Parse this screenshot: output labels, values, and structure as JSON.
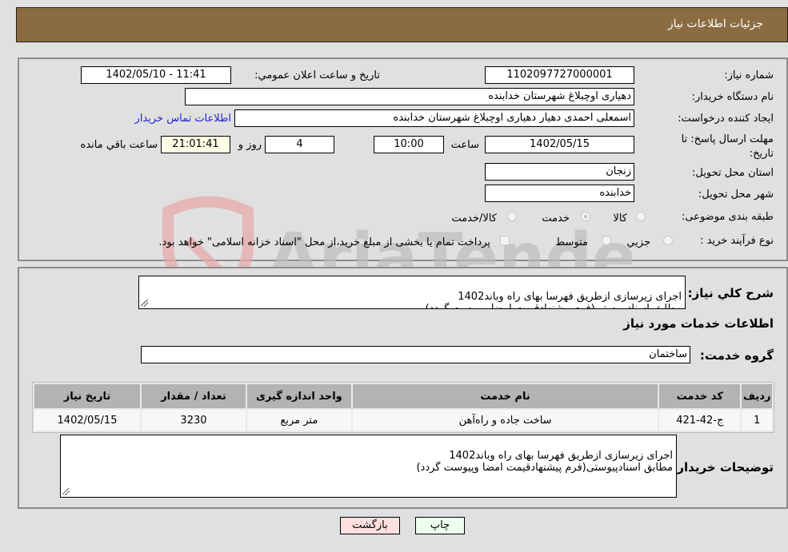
{
  "header": {
    "title": "جزئیات اطلاعات نیاز"
  },
  "fields": {
    "need_number": {
      "label": "شماره نیاز:",
      "value": "1102097727000001"
    },
    "announce_datetime": {
      "label": "تاریخ و ساعت اعلان عمومي:",
      "value": "1402/05/10 - 11:41"
    },
    "buyer_org": {
      "label": "نام دستگاه خریدار:",
      "value": "دهیاری اوچبلاغ شهرستان خدابنده"
    },
    "requester": {
      "label": "ایجاد کننده درخواست:",
      "value": "اسمعلی احمدی دهیار دهیاری اوچبلاغ شهرستان خدابنده"
    },
    "contact_link": "اطلاعات تماس خریدار",
    "deadline": {
      "label": "مهلت ارسال پاسخ: تا تاریخ:",
      "date": "1402/05/15",
      "time_label": "ساعت",
      "time": "10:00",
      "days": "4",
      "days_label": "روز و",
      "remaining": "21:01:41",
      "remaining_label": "ساعت باقي مانده"
    },
    "province": {
      "label": "استان محل تحویل:",
      "value": "زنجان"
    },
    "city": {
      "label": "شهر محل تحویل:",
      "value": "خدابنده"
    },
    "category": {
      "label": "طبقه بندی موضوعی:",
      "options": [
        "کالا",
        "خدمت",
        "کالا/خدمت"
      ],
      "selected": "خدمت"
    },
    "purchase_type": {
      "label": "نوع فرآیند خرید :",
      "options": [
        "جزيي",
        "متوسط"
      ],
      "selected": "متوسط",
      "treasury_note": "پرداخت تمام یا بخشی از مبلغ خرید،از محل \"اسناد خزانه اسلامی\" خواهد بود."
    }
  },
  "description": {
    "label": "شرح کلي نیاز:",
    "text": "اجرای زیرسازی ازطریق فهرسا بهای راه وباند1402\nمطابق اسنادپیوستی(فرم پیشنهادقیمت امضا وپیوست گردد)"
  },
  "services_section": {
    "title": "اطلاعات خدمات مورد نیاز",
    "group_label": "گروه خدمت:",
    "group_value": "ساختمان",
    "table": {
      "headers": [
        "ردیف",
        "کد خدمت",
        "نام خدمت",
        "واحد اندازه گیری",
        "تعداد / مقدار",
        "تاریخ نیاز"
      ],
      "rows": [
        [
          "1",
          "ج-42-421",
          "ساخت جاده و راه‌آهن",
          "متر مربع",
          "3230",
          "1402/05/15"
        ]
      ]
    }
  },
  "buyer_notes": {
    "label": "توضیحات خریدار:",
    "text": "اجرای زیرسازی ازطریق فهرسا بهای راه وباند1402\nمطابق اسنادپیوستی(فرم پیشنهادقیمت امضا وپیوست گردد)"
  },
  "buttons": {
    "print": "چاپ",
    "back": "بازگشت"
  },
  "watermark": "AriaTender.neT"
}
